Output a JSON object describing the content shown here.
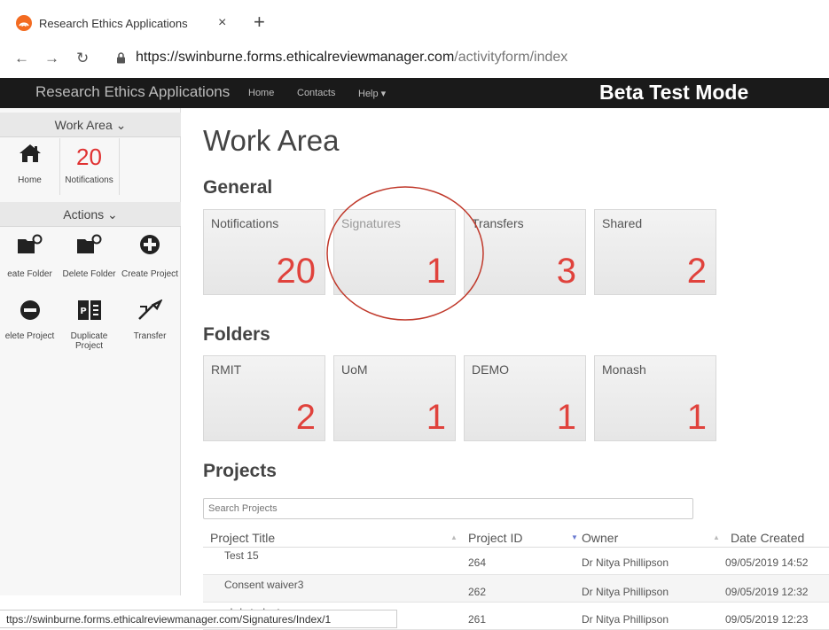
{
  "browser": {
    "tab_title": "Research Ethics Applications",
    "close_glyph": "×",
    "new_tab_glyph": "+",
    "url_host": "https://swinburne.forms.ethicalreviewmanager.com",
    "url_path": "/activityform/index",
    "status_url": "ttps://swinburne.forms.ethicalreviewmanager.com/Signatures/Index/1"
  },
  "navbar": {
    "brand": "Research Ethics Applications",
    "links": [
      "Home",
      "Contacts",
      "Help ▾"
    ],
    "mode": "Beta Test Mode"
  },
  "sidebar": {
    "work_area_header": "Work Area ⌄",
    "home_label": "Home",
    "notifications_count": "20",
    "notifications_label": "Notifications",
    "actions_header": "Actions ⌄",
    "actions": [
      {
        "label": "eate Folder",
        "icon": "folder-add-icon"
      },
      {
        "label": "Delete Folder",
        "icon": "folder-delete-icon"
      },
      {
        "label": "Create Project",
        "icon": "plus-circle-icon"
      },
      {
        "label": "elete Project",
        "icon": "minus-circle-icon"
      },
      {
        "label": "Duplicate\nProject",
        "icon": "duplicate-icon"
      },
      {
        "label": "Transfer",
        "icon": "transfer-icon"
      }
    ]
  },
  "main": {
    "title": "Work Area",
    "general_title": "General",
    "general_tiles": [
      {
        "label": "Notifications",
        "count": "20"
      },
      {
        "label": "Signatures",
        "count": "1"
      },
      {
        "label": "Transfers",
        "count": "3"
      },
      {
        "label": "Shared",
        "count": "2"
      }
    ],
    "folders_title": "Folders",
    "folder_tiles": [
      {
        "label": "RMIT",
        "count": "2"
      },
      {
        "label": "UoM",
        "count": "1"
      },
      {
        "label": "DEMO",
        "count": "1"
      },
      {
        "label": "Monash",
        "count": "1"
      }
    ],
    "projects_title": "Projects",
    "search_placeholder": "Search Projects",
    "columns": [
      "Project Title",
      "Project ID",
      "Owner",
      "Date Created"
    ],
    "rows": [
      [
        "Test 15",
        "264",
        "Dr Nitya Phillipson",
        "09/05/2019 14:52"
      ],
      [
        "Consent waiver3",
        "262",
        "Dr Nitya Phillipson",
        "09/05/2019 12:32"
      ],
      [
        "phd students",
        "261",
        "Dr Nitya Phillipson",
        "09/05/2019 12:23"
      ]
    ]
  },
  "colors": {
    "accent_red": "#e0423c",
    "navbar_bg": "#1a1a1a"
  }
}
